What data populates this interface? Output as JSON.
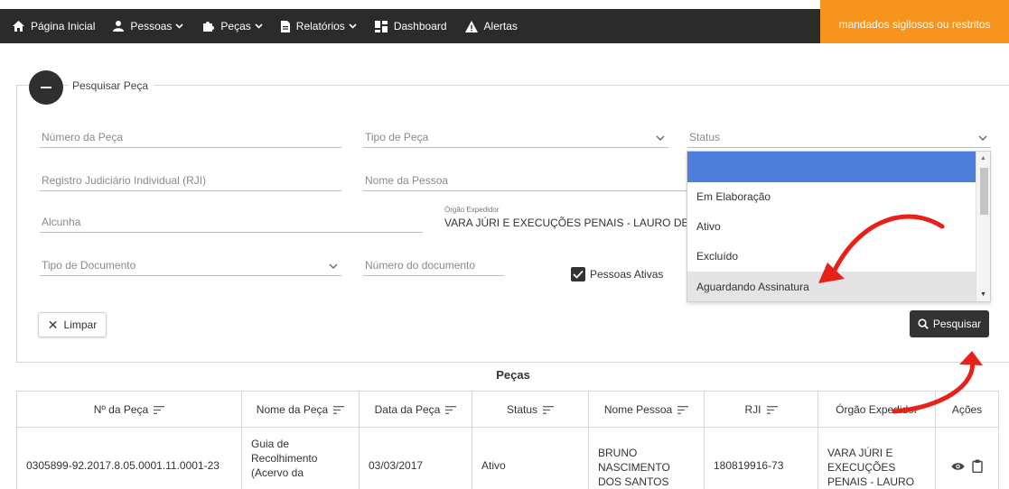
{
  "nav": {
    "items": [
      {
        "label": "Página Inicial",
        "icon": "home-icon",
        "dropdown": false
      },
      {
        "label": "Pessoas",
        "icon": "person-icon",
        "dropdown": true
      },
      {
        "label": "Peças",
        "icon": "puzzle-icon",
        "dropdown": true
      },
      {
        "label": "Relatórios",
        "icon": "document-icon",
        "dropdown": true
      },
      {
        "label": "Dashboard",
        "icon": "dashboard-icon",
        "dropdown": false
      },
      {
        "label": "Alertas",
        "icon": "warning-icon",
        "dropdown": false
      }
    ],
    "banner": "mandados sigilosos ou restritos",
    "banner_color": "#f7941d"
  },
  "search_panel": {
    "title": "Pesquisar Peça",
    "fields": {
      "numero_peca": {
        "placeholder": "Número da Peça"
      },
      "tipo_peca": {
        "placeholder": "Tipo de Peça"
      },
      "status": {
        "placeholder": "Status"
      },
      "rji": {
        "placeholder": "Registro Judiciário Individual (RJI)"
      },
      "nome_pessoa": {
        "placeholder": "Nome da Pessoa"
      },
      "alcunha": {
        "placeholder": "Alcunha"
      },
      "orgao_expedidor": {
        "label": "Órgão Expedidor",
        "value": "VARA JÚRI E EXECUÇÕES PENAIS - LAURO DE FREITAS"
      },
      "tipo_documento": {
        "placeholder": "Tipo de Documento"
      },
      "numero_documento": {
        "placeholder": "Número do documento"
      }
    },
    "pessoas_ativas": {
      "label": "Pessoas Ativas",
      "checked": true
    },
    "clear_label": "Limpar",
    "search_label": "Pesquisar"
  },
  "status_dropdown": {
    "options": [
      "",
      "Em Elaboração",
      "Ativo",
      "Excluído",
      "Aguardando Assinatura"
    ],
    "highlighted_color": "#4f7fdb"
  },
  "table": {
    "title": "Peças",
    "columns": [
      "Nº da Peça",
      "Nome da Peça",
      "Data da Peça",
      "Status",
      "Nome Pessoa",
      "RJI",
      "Órgão Expedidor",
      "Ações"
    ],
    "rows": [
      {
        "numero": "0305899-92.2017.8.05.0001.11.0001-23",
        "nome_peca": "Guia de Recolhimento (Acervo da",
        "data": "03/03/2017",
        "status": "Ativo",
        "nome_pessoa": "BRUNO NASCIMENTO DOS SANTOS",
        "rji": "180819916-73",
        "orgao": "VARA JÚRI E EXECUÇÕES PENAIS - LAURO DE FREITAS"
      }
    ]
  },
  "colors": {
    "nav_bg": "#2b2b2b",
    "annotation_arrow": "#e8201a",
    "primary_button": "#333333"
  }
}
